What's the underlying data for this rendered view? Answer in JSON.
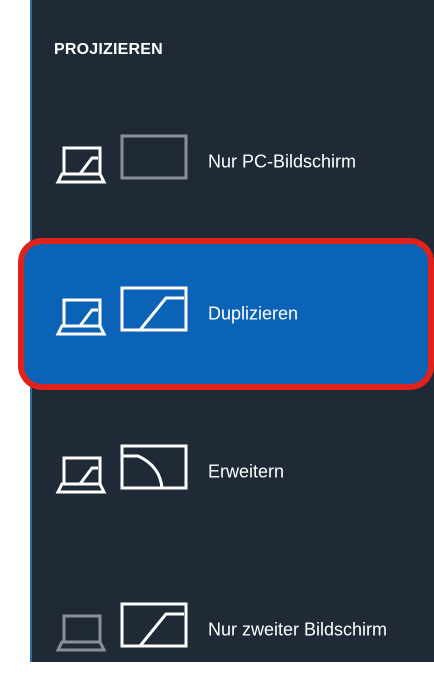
{
  "panel": {
    "title": "PROJIZIEREN",
    "items": [
      {
        "label": "Nur PC-Bildschirm",
        "icon": "pc-only-icon",
        "selected": false
      },
      {
        "label": "Duplizieren",
        "icon": "duplicate-icon",
        "selected": true
      },
      {
        "label": "Erweitern",
        "icon": "extend-icon",
        "selected": false
      },
      {
        "label": "Nur zweiter Bildschirm",
        "icon": "second-screen-only-icon",
        "selected": false
      }
    ]
  },
  "colors": {
    "panel_bg": "#1f2a36",
    "selected_bg": "#0b63b7",
    "highlight_outline": "#e0221a",
    "text": "#ffffff",
    "dim_icon": "#8a9099"
  }
}
